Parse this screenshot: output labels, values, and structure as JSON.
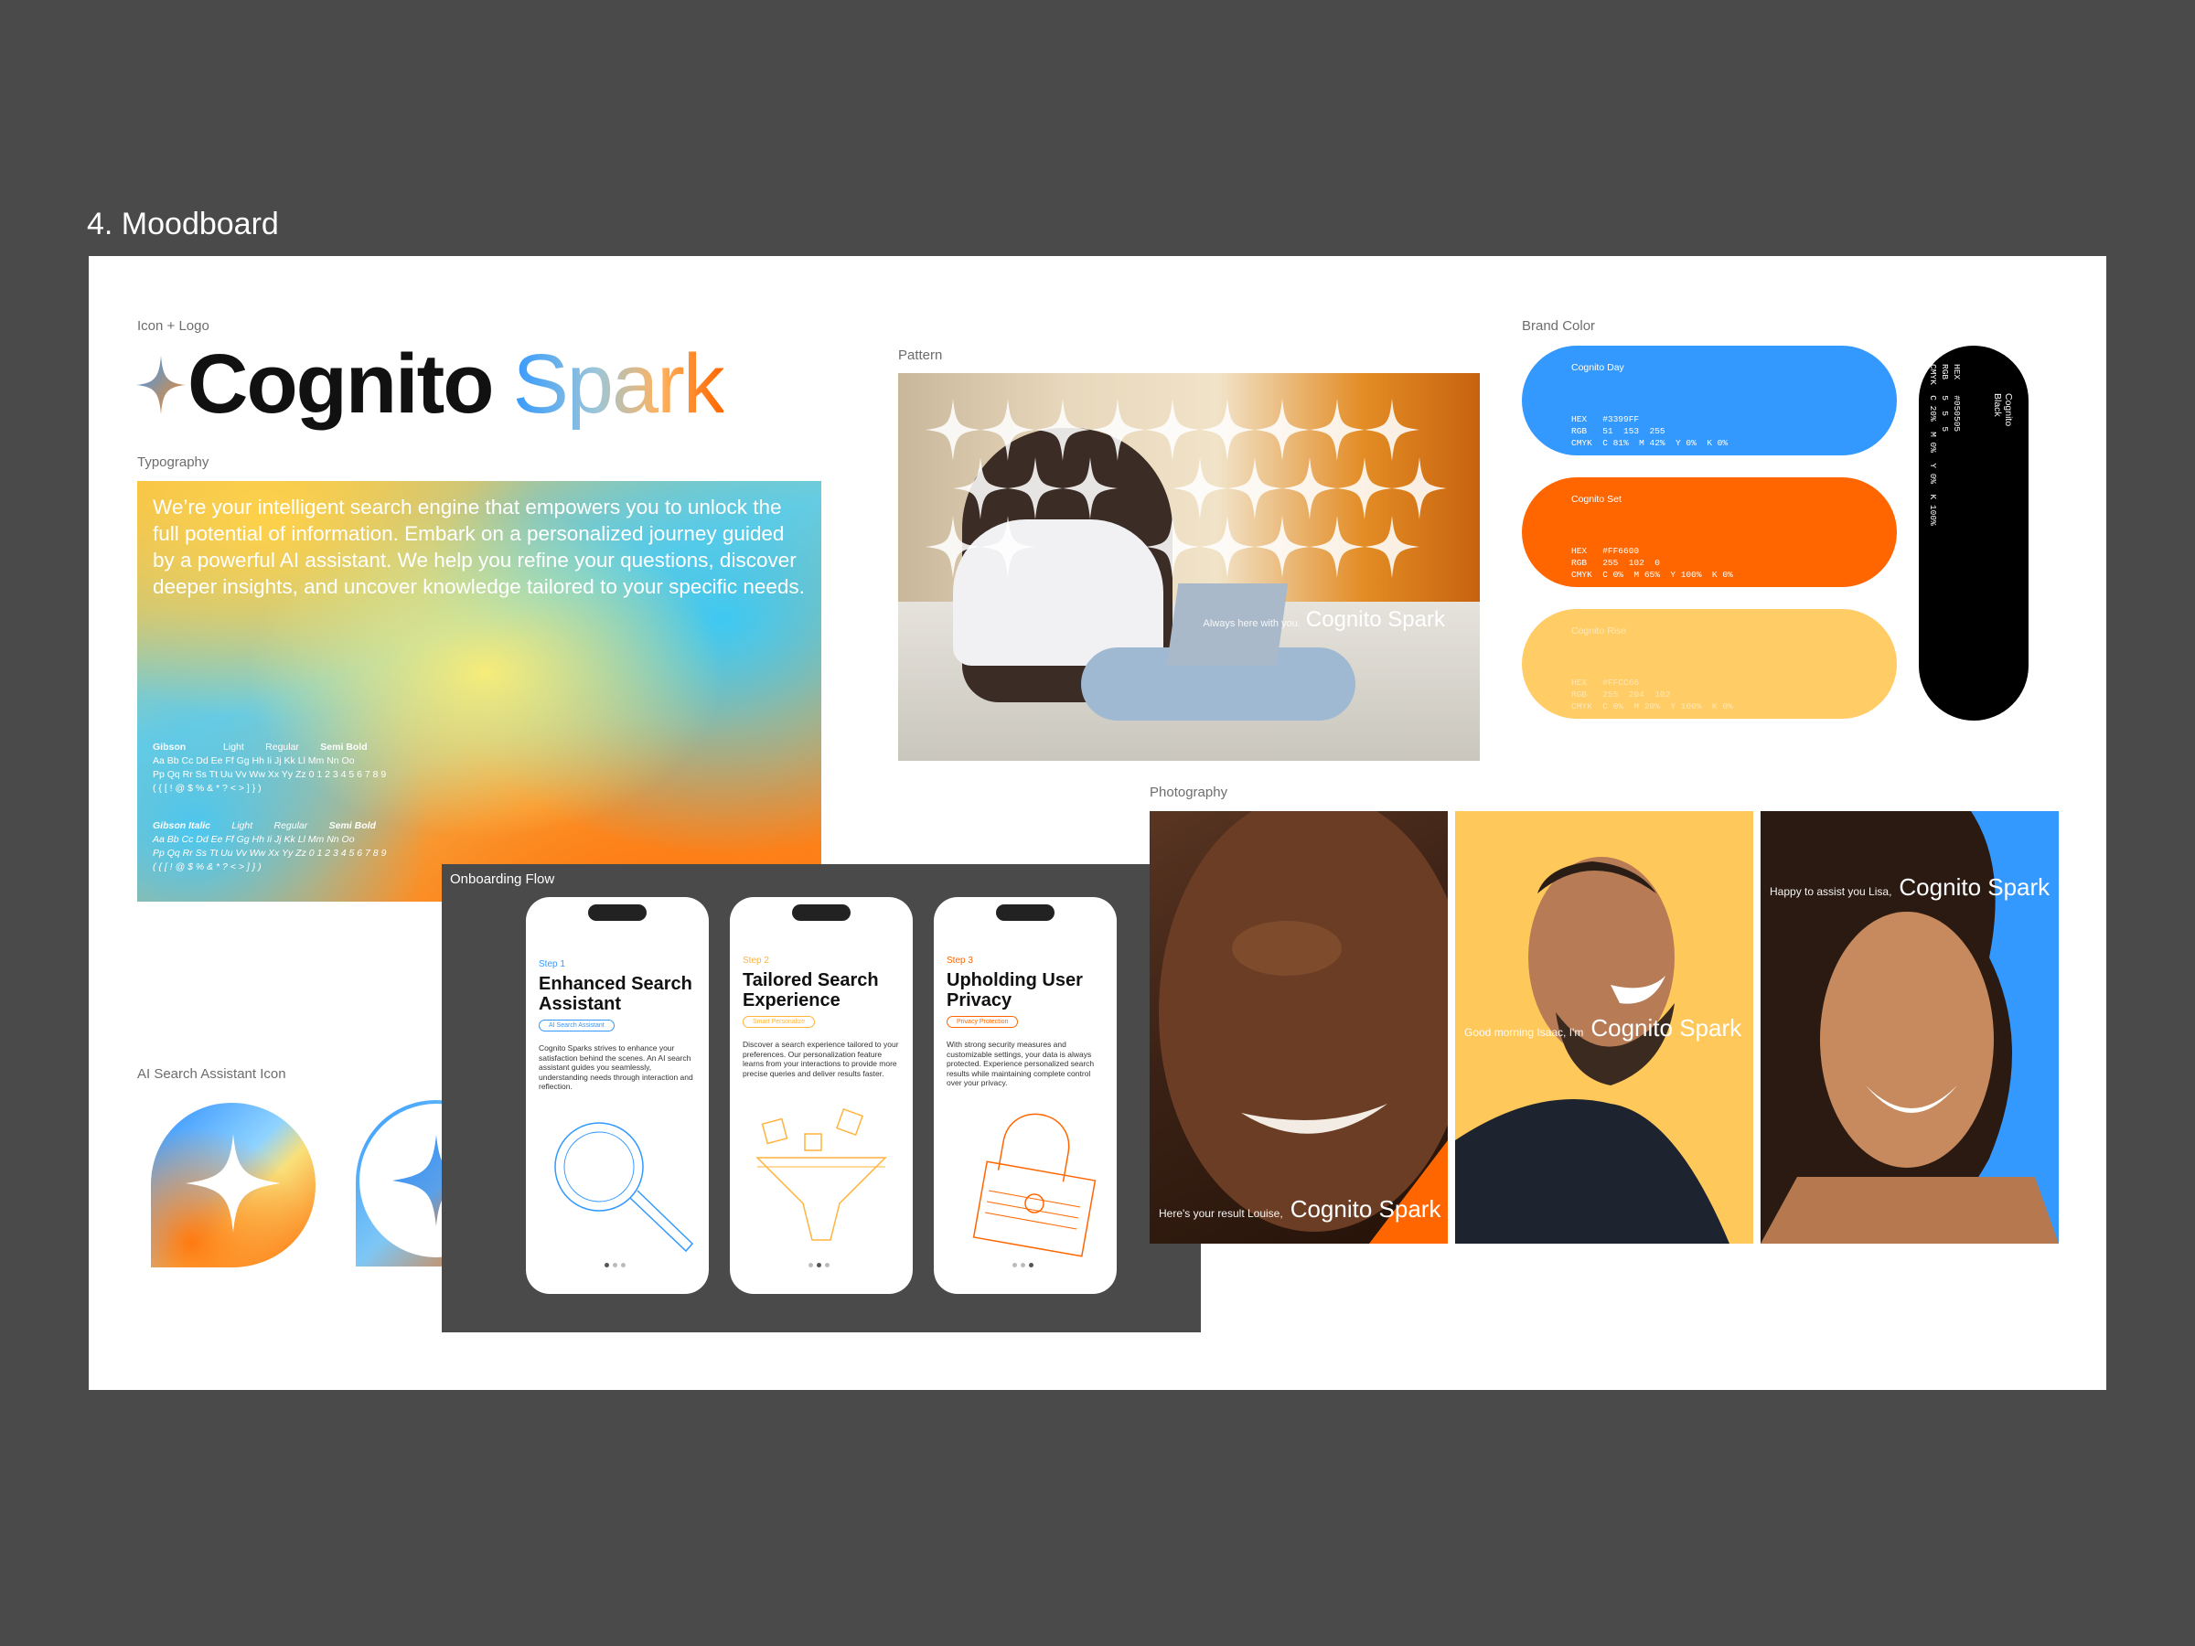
{
  "page_title": "4. Moodboard",
  "sections": {
    "icon_logo": "Icon + Logo",
    "typography": "Typography",
    "pattern": "Pattern",
    "brand_color": "Brand Color",
    "photography": "Photography",
    "onboarding": "Onboarding Flow",
    "ai_icon": "AI Search Assistant Icon"
  },
  "logo": {
    "word1": "Cognito",
    "word2": "Spark"
  },
  "typography": {
    "paragraph": "We’re your intelligent search engine that empowers you to unlock the full potential of information. Embark on a personalized journey guided by a powerful AI assistant. We help you refine your questions, discover deeper insights, and uncover knowledge tailored to your specific needs.",
    "font1": {
      "name": "Gibson",
      "w1": "Light",
      "w2": "Regular",
      "w3": "Semi Bold"
    },
    "font2": {
      "name": "Gibson Italic",
      "w1": "Light",
      "w2": "Regular",
      "w3": "Semi Bold"
    },
    "alphabet": "Aa Bb Cc Dd Ee Ff Gg Hh Ii Jj Kk Ll Mm Nn Oo",
    "alphabet2": "Pp Qq Rr Ss Tt Uu Vv Ww Xx Yy Zz 0 1 2 3 4 5 6 7 8 9",
    "symbols": "( { [ ! @ $ % & * ? < > ] } )"
  },
  "pattern": {
    "small": "Always here with you.",
    "brand": "Cognito Spark"
  },
  "colors": [
    {
      "name": "Cognito Day",
      "hex": "#3399FF",
      "values": "HEX   #3399FF\nRGB   51  153  255\nCMYK  C 81%  M 42%  Y 0%  K 0%"
    },
    {
      "name": "Cognito Set",
      "hex": "#FF6600",
      "values": "HEX   #FF6600\nRGB   255  102  0\nCMYK  C 0%  M 65%  Y 100%  K 0%"
    },
    {
      "name": "Cognito Rise",
      "hex": "#FFCC66",
      "values": "HEX   #FFCC66\nRGB   255  204  102\nCMYK  C 0%  M 20%  Y 100%  K 0%"
    },
    {
      "name": "Cognito Black",
      "hex": "#000000",
      "values": "HEX   #050505\nRGB   5  5  5\nCMYK  C 20%  M 0%  Y 0%  K 100%"
    }
  ],
  "onboarding": [
    {
      "step": "Step 1",
      "title": "Enhanced Search Assistant",
      "chip": "AI Search Assistant",
      "color": "#3399FF",
      "body": "Cognito Sparks strives to enhance your satisfaction behind the scenes. An AI search assistant guides you seamlessly, understanding needs through interaction and reflection."
    },
    {
      "step": "Step 2",
      "title": "Tailored Search Experience",
      "chip": "Smart Personalize",
      "color": "#FFB43C",
      "body": "Discover a search experience tailored to your preferences. Our personalization feature learns from your interactions to provide more precise queries and deliver results faster."
    },
    {
      "step": "Step 3",
      "title": "Upholding User Privacy",
      "chip": "Privacy Protection",
      "color": "#FF6600",
      "body": "With strong security measures and customizable settings, your data is always protected. Experience personalized search results while maintaining complete control over your privacy."
    }
  ],
  "photos": [
    {
      "small": "Here's your result Louise,",
      "brand": "Cognito Spark"
    },
    {
      "small": "Good morning Isaac, I'm",
      "brand": "Cognito Spark"
    },
    {
      "small": "Happy to assist you Lisa,",
      "brand": "Cognito Spark"
    }
  ]
}
